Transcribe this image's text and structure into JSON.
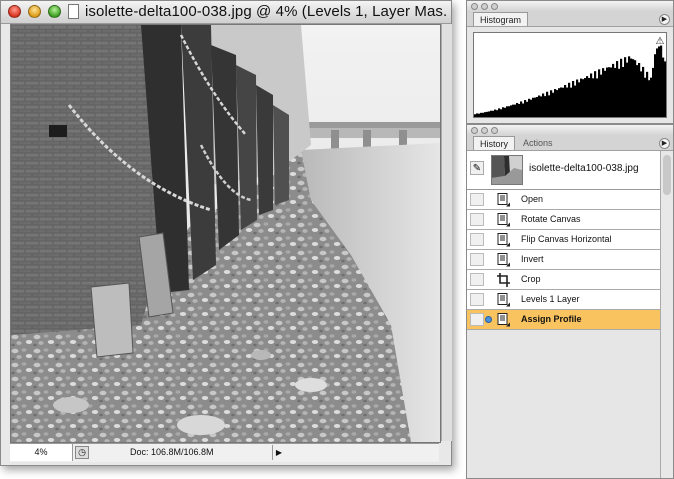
{
  "document": {
    "title": "isolette-delta100-038.jpg @ 4% (Levels 1, Layer Mas...",
    "zoom": "4%",
    "doc_size": "Doc: 106.8M/106.8M"
  },
  "histogram_panel": {
    "tab_label": "Histogram",
    "warning_icon": "warning-triangle-icon",
    "menu_icon": "panel-menu-arrow-icon"
  },
  "history_panel": {
    "tabs": [
      {
        "label": "History",
        "active": true
      },
      {
        "label": "Actions",
        "active": false
      }
    ],
    "snapshot_label": "isolette-delta100-038.jpg",
    "items": [
      {
        "label": "Open",
        "icon": "action-document-icon",
        "selected": false
      },
      {
        "label": "Rotate Canvas",
        "icon": "action-document-icon",
        "selected": false
      },
      {
        "label": "Flip Canvas Horizontal",
        "icon": "action-document-icon",
        "selected": false
      },
      {
        "label": "Invert",
        "icon": "action-document-icon",
        "selected": false
      },
      {
        "label": "Crop",
        "icon": "crop-icon",
        "selected": false
      },
      {
        "label": "Levels 1 Layer",
        "icon": "action-document-icon",
        "selected": false
      },
      {
        "label": "Assign Profile",
        "icon": "action-document-icon",
        "selected": true
      }
    ]
  },
  "colors": {
    "selection": "#f9c35f",
    "state_marker": "#4a8fd8"
  }
}
